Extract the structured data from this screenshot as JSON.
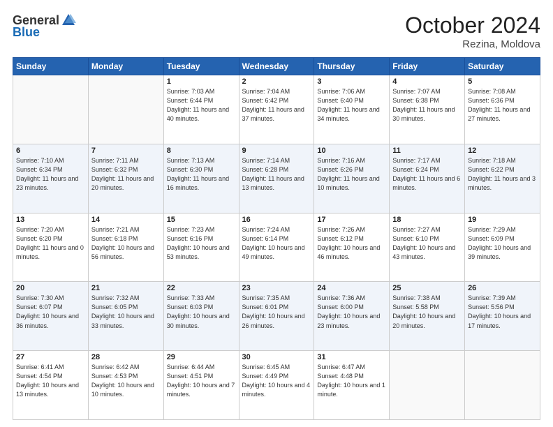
{
  "header": {
    "logo_general": "General",
    "logo_blue": "Blue",
    "month_title": "October 2024",
    "location": "Rezina, Moldova"
  },
  "weekdays": [
    "Sunday",
    "Monday",
    "Tuesday",
    "Wednesday",
    "Thursday",
    "Friday",
    "Saturday"
  ],
  "weeks": [
    [
      {
        "day": "",
        "sunrise": "",
        "sunset": "",
        "daylight": ""
      },
      {
        "day": "",
        "sunrise": "",
        "sunset": "",
        "daylight": ""
      },
      {
        "day": "1",
        "sunrise": "Sunrise: 7:03 AM",
        "sunset": "Sunset: 6:44 PM",
        "daylight": "Daylight: 11 hours and 40 minutes."
      },
      {
        "day": "2",
        "sunrise": "Sunrise: 7:04 AM",
        "sunset": "Sunset: 6:42 PM",
        "daylight": "Daylight: 11 hours and 37 minutes."
      },
      {
        "day": "3",
        "sunrise": "Sunrise: 7:06 AM",
        "sunset": "Sunset: 6:40 PM",
        "daylight": "Daylight: 11 hours and 34 minutes."
      },
      {
        "day": "4",
        "sunrise": "Sunrise: 7:07 AM",
        "sunset": "Sunset: 6:38 PM",
        "daylight": "Daylight: 11 hours and 30 minutes."
      },
      {
        "day": "5",
        "sunrise": "Sunrise: 7:08 AM",
        "sunset": "Sunset: 6:36 PM",
        "daylight": "Daylight: 11 hours and 27 minutes."
      }
    ],
    [
      {
        "day": "6",
        "sunrise": "Sunrise: 7:10 AM",
        "sunset": "Sunset: 6:34 PM",
        "daylight": "Daylight: 11 hours and 23 minutes."
      },
      {
        "day": "7",
        "sunrise": "Sunrise: 7:11 AM",
        "sunset": "Sunset: 6:32 PM",
        "daylight": "Daylight: 11 hours and 20 minutes."
      },
      {
        "day": "8",
        "sunrise": "Sunrise: 7:13 AM",
        "sunset": "Sunset: 6:30 PM",
        "daylight": "Daylight: 11 hours and 16 minutes."
      },
      {
        "day": "9",
        "sunrise": "Sunrise: 7:14 AM",
        "sunset": "Sunset: 6:28 PM",
        "daylight": "Daylight: 11 hours and 13 minutes."
      },
      {
        "day": "10",
        "sunrise": "Sunrise: 7:16 AM",
        "sunset": "Sunset: 6:26 PM",
        "daylight": "Daylight: 11 hours and 10 minutes."
      },
      {
        "day": "11",
        "sunrise": "Sunrise: 7:17 AM",
        "sunset": "Sunset: 6:24 PM",
        "daylight": "Daylight: 11 hours and 6 minutes."
      },
      {
        "day": "12",
        "sunrise": "Sunrise: 7:18 AM",
        "sunset": "Sunset: 6:22 PM",
        "daylight": "Daylight: 11 hours and 3 minutes."
      }
    ],
    [
      {
        "day": "13",
        "sunrise": "Sunrise: 7:20 AM",
        "sunset": "Sunset: 6:20 PM",
        "daylight": "Daylight: 11 hours and 0 minutes."
      },
      {
        "day": "14",
        "sunrise": "Sunrise: 7:21 AM",
        "sunset": "Sunset: 6:18 PM",
        "daylight": "Daylight: 10 hours and 56 minutes."
      },
      {
        "day": "15",
        "sunrise": "Sunrise: 7:23 AM",
        "sunset": "Sunset: 6:16 PM",
        "daylight": "Daylight: 10 hours and 53 minutes."
      },
      {
        "day": "16",
        "sunrise": "Sunrise: 7:24 AM",
        "sunset": "Sunset: 6:14 PM",
        "daylight": "Daylight: 10 hours and 49 minutes."
      },
      {
        "day": "17",
        "sunrise": "Sunrise: 7:26 AM",
        "sunset": "Sunset: 6:12 PM",
        "daylight": "Daylight: 10 hours and 46 minutes."
      },
      {
        "day": "18",
        "sunrise": "Sunrise: 7:27 AM",
        "sunset": "Sunset: 6:10 PM",
        "daylight": "Daylight: 10 hours and 43 minutes."
      },
      {
        "day": "19",
        "sunrise": "Sunrise: 7:29 AM",
        "sunset": "Sunset: 6:09 PM",
        "daylight": "Daylight: 10 hours and 39 minutes."
      }
    ],
    [
      {
        "day": "20",
        "sunrise": "Sunrise: 7:30 AM",
        "sunset": "Sunset: 6:07 PM",
        "daylight": "Daylight: 10 hours and 36 minutes."
      },
      {
        "day": "21",
        "sunrise": "Sunrise: 7:32 AM",
        "sunset": "Sunset: 6:05 PM",
        "daylight": "Daylight: 10 hours and 33 minutes."
      },
      {
        "day": "22",
        "sunrise": "Sunrise: 7:33 AM",
        "sunset": "Sunset: 6:03 PM",
        "daylight": "Daylight: 10 hours and 30 minutes."
      },
      {
        "day": "23",
        "sunrise": "Sunrise: 7:35 AM",
        "sunset": "Sunset: 6:01 PM",
        "daylight": "Daylight: 10 hours and 26 minutes."
      },
      {
        "day": "24",
        "sunrise": "Sunrise: 7:36 AM",
        "sunset": "Sunset: 6:00 PM",
        "daylight": "Daylight: 10 hours and 23 minutes."
      },
      {
        "day": "25",
        "sunrise": "Sunrise: 7:38 AM",
        "sunset": "Sunset: 5:58 PM",
        "daylight": "Daylight: 10 hours and 20 minutes."
      },
      {
        "day": "26",
        "sunrise": "Sunrise: 7:39 AM",
        "sunset": "Sunset: 5:56 PM",
        "daylight": "Daylight: 10 hours and 17 minutes."
      }
    ],
    [
      {
        "day": "27",
        "sunrise": "Sunrise: 6:41 AM",
        "sunset": "Sunset: 4:54 PM",
        "daylight": "Daylight: 10 hours and 13 minutes."
      },
      {
        "day": "28",
        "sunrise": "Sunrise: 6:42 AM",
        "sunset": "Sunset: 4:53 PM",
        "daylight": "Daylight: 10 hours and 10 minutes."
      },
      {
        "day": "29",
        "sunrise": "Sunrise: 6:44 AM",
        "sunset": "Sunset: 4:51 PM",
        "daylight": "Daylight: 10 hours and 7 minutes."
      },
      {
        "day": "30",
        "sunrise": "Sunrise: 6:45 AM",
        "sunset": "Sunset: 4:49 PM",
        "daylight": "Daylight: 10 hours and 4 minutes."
      },
      {
        "day": "31",
        "sunrise": "Sunrise: 6:47 AM",
        "sunset": "Sunset: 4:48 PM",
        "daylight": "Daylight: 10 hours and 1 minute."
      },
      {
        "day": "",
        "sunrise": "",
        "sunset": "",
        "daylight": ""
      },
      {
        "day": "",
        "sunrise": "",
        "sunset": "",
        "daylight": ""
      }
    ]
  ]
}
